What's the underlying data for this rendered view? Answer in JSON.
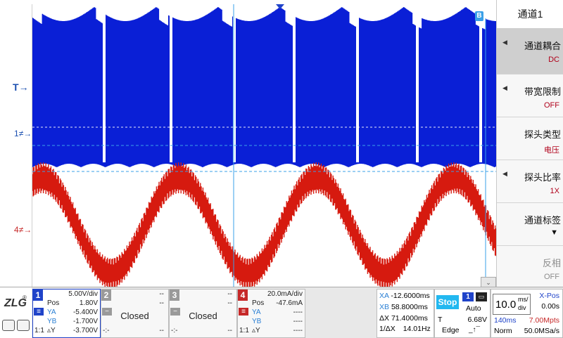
{
  "markers": {
    "trigger": "T",
    "ch1": "1",
    "ch4": "4"
  },
  "cursor_badge": "B",
  "right_panel": {
    "title": "通道1",
    "items": [
      {
        "label": "通道耦合",
        "value": "DC",
        "active": true
      },
      {
        "label": "带宽限制",
        "value": "OFF"
      },
      {
        "label": "探头类型",
        "value": "电压"
      },
      {
        "label": "探头比率",
        "value": "1X"
      },
      {
        "label": "通道标签",
        "value": ""
      },
      {
        "label": "反相",
        "value": "OFF"
      }
    ]
  },
  "logo": {
    "text": "ZLG",
    "reg": "®"
  },
  "channels": [
    {
      "num": "1",
      "scale": "5.00V/div",
      "pos_label": "Pos",
      "pos": "1.80V",
      "ya": "-5.400V",
      "yb": "-1.700V",
      "dy": "-3.700V",
      "coupling": "1:1",
      "color": "#1f43c9"
    },
    {
      "num": "2",
      "top": "--",
      "mid": "--",
      "status": "Closed",
      "bottom": "--",
      "color": "#9a9a9a"
    },
    {
      "num": "3",
      "top": "--",
      "mid": "--",
      "status": "Closed",
      "bottom": "--",
      "color": "#9a9a9a"
    },
    {
      "num": "4",
      "scale": "20.0mA/div",
      "pos_label": "Pos",
      "pos": "-47.6mA",
      "ya": "----",
      "yb": "----",
      "dy": "----",
      "coupling": "1:1",
      "color": "#c62828"
    }
  ],
  "cursors": {
    "xa_label": "XA",
    "xa": "-12.6000ms",
    "xb_label": "XB",
    "xb": "58.8000ms",
    "dx_label": "ΔX",
    "dx": "71.4000ms",
    "inv_label": "1/ΔX",
    "inv": "14.01Hz"
  },
  "trigger": {
    "state": "Stop",
    "source": "1",
    "mode": "Auto",
    "level_label": "T",
    "level": "6.68V",
    "type": "Edge"
  },
  "timebase": {
    "scale": "10.0",
    "scale_unit_top": "ms/",
    "scale_unit_bottom": "div",
    "xpos_label": "X-Pos",
    "xpos": "0.00s",
    "length": "140ms",
    "points": "7.00Mpts",
    "mode": "Norm",
    "rate": "50.0MSa/s"
  },
  "colors": {
    "ch1": "#0a1fd6",
    "ch4": "#d61a0f",
    "cursor": "#3aa0e8"
  }
}
